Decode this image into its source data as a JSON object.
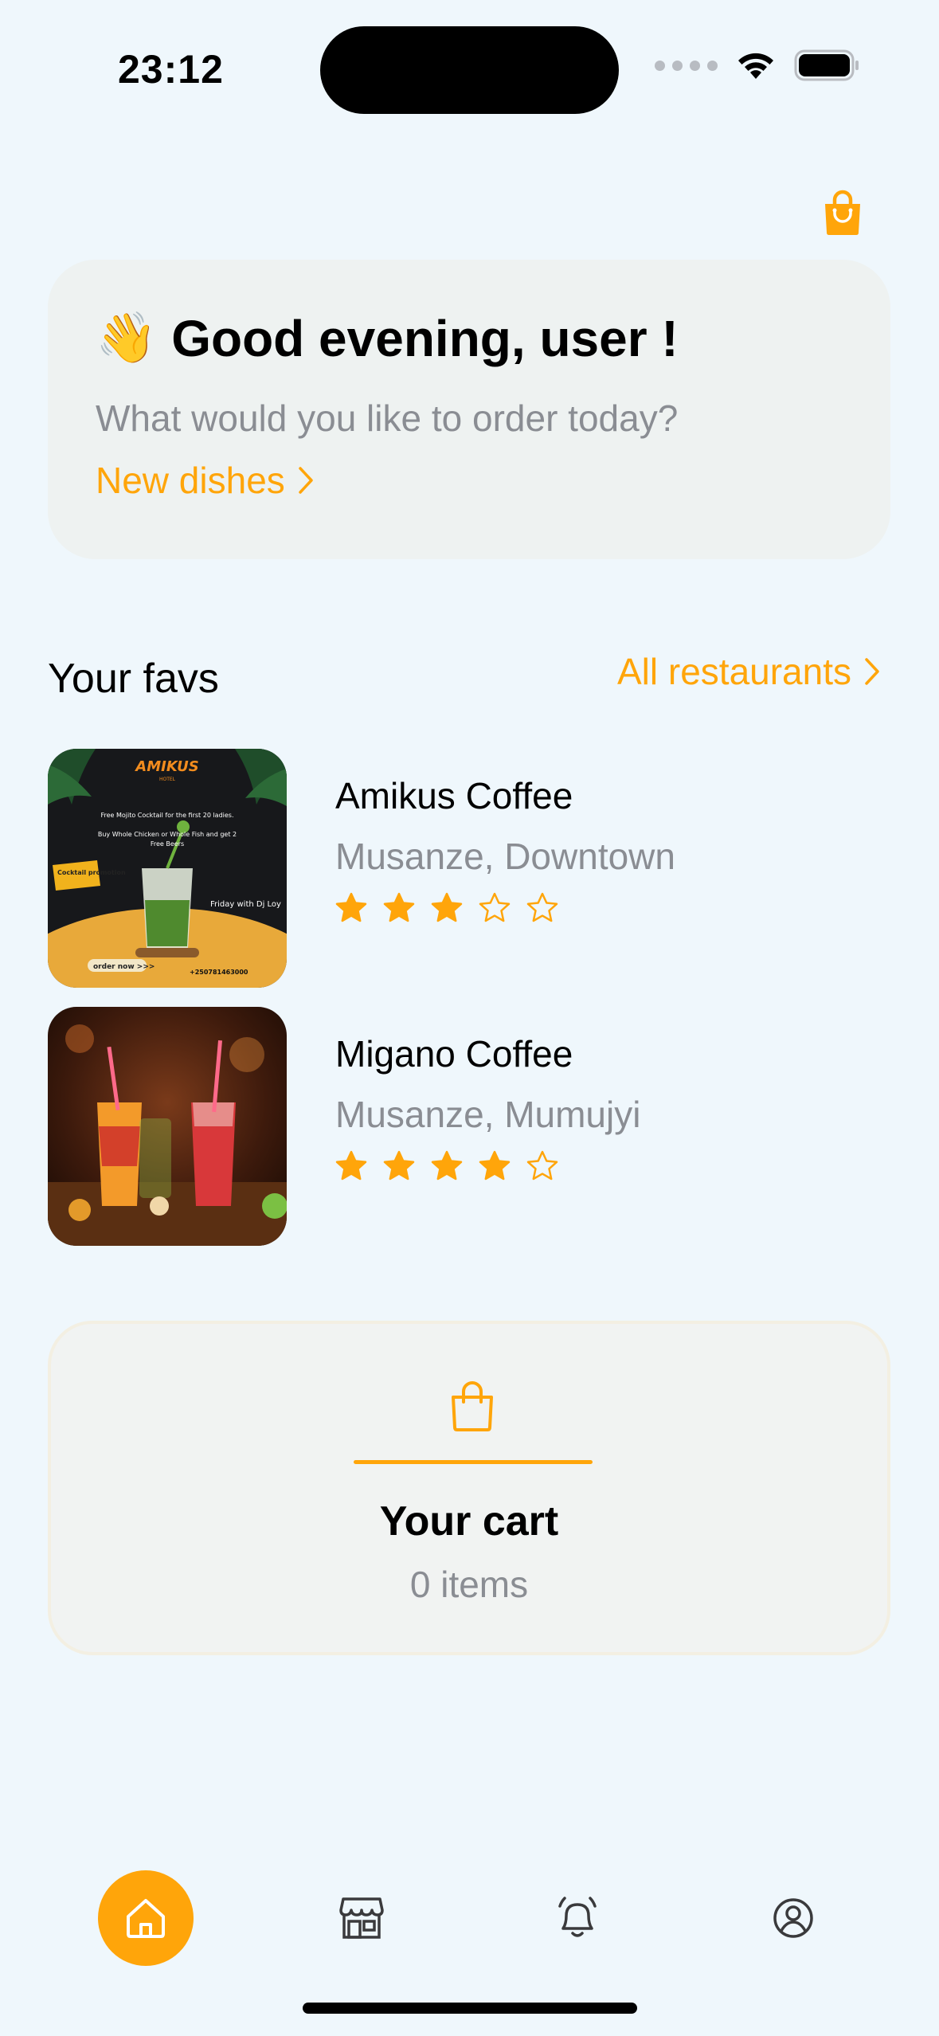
{
  "status_bar": {
    "time": "23:12"
  },
  "greeting": {
    "emoji": "👋",
    "title": "Good evening, user !",
    "subtitle": "What would you like to order today?",
    "link_label": "New dishes"
  },
  "favs": {
    "title": "Your favs",
    "all_link": "All restaurants",
    "items": [
      {
        "name": "Amikus Coffee",
        "location": "Musanze, Downtown",
        "rating": 3,
        "max_rating": 5,
        "poster": {
          "brand": "AMIKUS",
          "brand_sub": "HOTEL",
          "line1": "Free Mojito Cocktail for the first 20 ladies.",
          "line2": "Buy Whole Chicken or Whole Fish and get 2",
          "line3": "Free Beers",
          "badge": "Cocktail promotion",
          "dj": "Friday with Dj Loy",
          "cta": "order now >>>",
          "phone": "+250781463000"
        }
      },
      {
        "name": "Migano Coffee",
        "location": "Musanze, Mumujyi",
        "rating": 4,
        "max_rating": 5
      }
    ]
  },
  "cart": {
    "title": "Your cart",
    "count_label": "0 items"
  },
  "colors": {
    "accent": "#ffa50a",
    "background": "#eff7fc",
    "muted": "#8a8d93"
  },
  "nav": {
    "items": [
      "home-icon",
      "store-icon",
      "bell-icon",
      "profile-icon"
    ],
    "active": "home-icon"
  }
}
